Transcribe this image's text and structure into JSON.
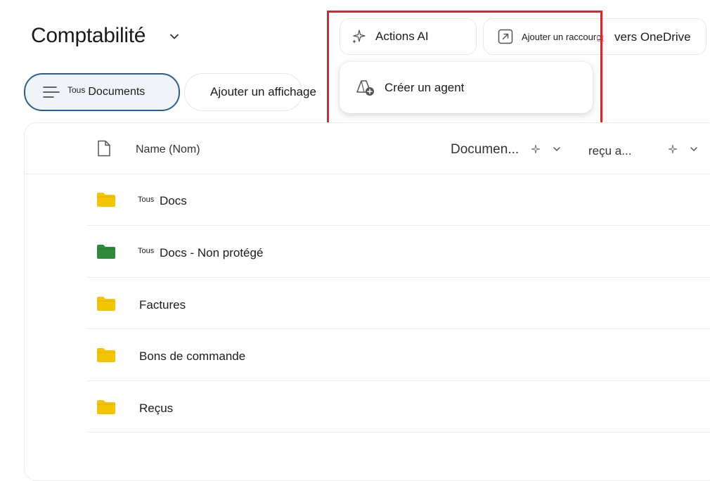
{
  "header": {
    "title": "Comptabilité",
    "title_menu_icon": "chevron-down-icon"
  },
  "toolbar": {
    "ai_actions_label": "Actions AI",
    "ai_actions_icon": "sparkle-icon",
    "shortcut_label_small": "Ajouter un raccourci",
    "shortcut_label_large": "vers OneDrive",
    "shortcut_icon": "arrow-up-right-box-icon"
  },
  "ai_menu": {
    "items": [
      {
        "label": "Créer un agent",
        "icon": "agent-add-icon"
      }
    ]
  },
  "views": {
    "current_prefix": "Tous",
    "current_label": "Documents",
    "current_icon": "list-lines-icon",
    "add_view_label": "Ajouter un affichage",
    "add_view_icon": "plus-icon"
  },
  "table": {
    "columns": [
      {
        "label": "Name (Nom)",
        "icon": "file-icon"
      },
      {
        "label": "Documen...",
        "icon": "sparkle-icon"
      },
      {
        "label": "reçu a...",
        "icon": "sparkle-icon"
      }
    ],
    "rows": [
      {
        "prefix": "Tous",
        "name": "Docs",
        "folder_color": "#f5c400"
      },
      {
        "prefix": "Tous",
        "name": "Docs - Non protégé",
        "folder_color": "#2e8b3a"
      },
      {
        "prefix": "",
        "name": "Factures",
        "folder_color": "#f5c400"
      },
      {
        "prefix": "",
        "name": "Bons de commande",
        "folder_color": "#f5c400"
      },
      {
        "prefix": "",
        "name": "Reçus",
        "folder_color": "#f5c400"
      }
    ]
  },
  "colors": {
    "highlight_border": "#d12a2f",
    "active_view_border": "#2a5f8f",
    "folder_yellow": "#f5c400",
    "folder_green": "#2e8b3a"
  }
}
